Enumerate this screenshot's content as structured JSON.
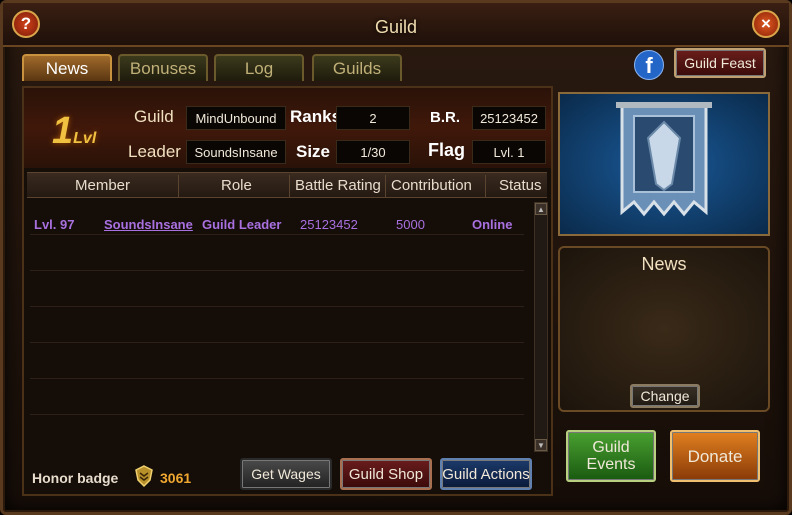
{
  "window": {
    "title": "Guild"
  },
  "tabs": [
    {
      "label": "News"
    },
    {
      "label": "Bonuses"
    },
    {
      "label": "Log"
    },
    {
      "label": "Guilds"
    }
  ],
  "buttons": {
    "guild_feast": "Guild Feast",
    "get_wages": "Get Wages",
    "guild_shop": "Guild Shop",
    "guild_actions": "Guild Actions",
    "change": "Change",
    "guild_events": "Guild Events",
    "donate": "Donate"
  },
  "guild_info": {
    "level_number": "1",
    "level_suffix": "Lvl",
    "guild_label": "Guild",
    "guild_name": "MindUnbound",
    "ranks_label": "Ranks",
    "ranks_value": "2",
    "br_label": "B.R.",
    "br_value": "25123452",
    "leader_label": "Leader",
    "leader_name": "SoundsInsane",
    "size_label": "Size",
    "size_value": "1/30",
    "flag_label": "Flag",
    "flag_value": "Lvl. 1"
  },
  "table": {
    "columns": [
      "Member",
      "Role",
      "Battle Rating",
      "Contribution",
      "Status"
    ],
    "rows": [
      {
        "level": "Lvl. 97",
        "member": "SoundsInsane",
        "role": "Guild Leader",
        "battle_rating": "25123452",
        "contribution": "5000",
        "status": "Online"
      }
    ]
  },
  "honor": {
    "label": "Honor badge",
    "value": "3061"
  },
  "news_panel": {
    "title": "News"
  },
  "icons": {
    "help": "?",
    "close": "×",
    "facebook": "f"
  }
}
